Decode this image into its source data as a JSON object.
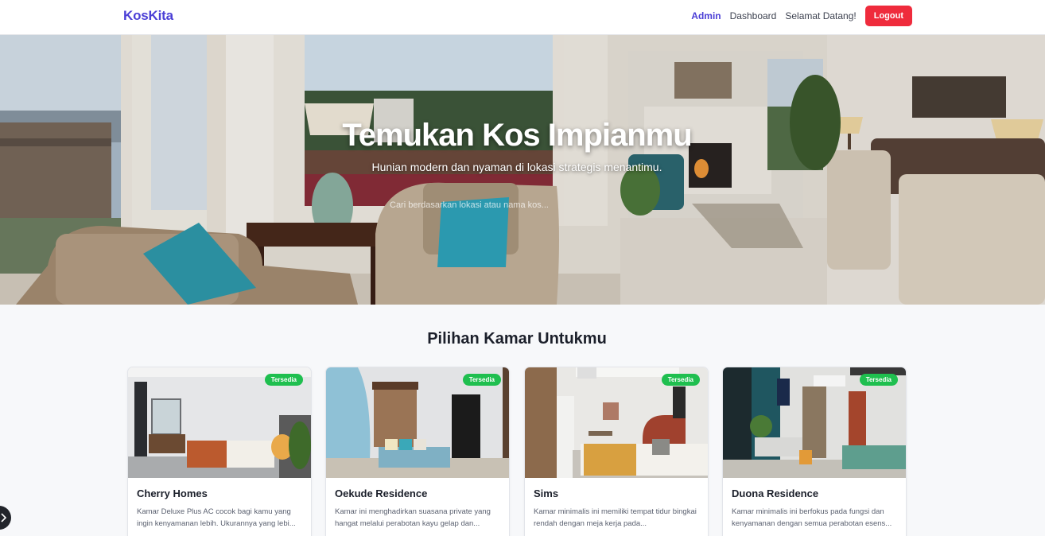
{
  "nav": {
    "brand": "KosKita",
    "links": [
      "Admin",
      "Dashboard",
      "Selamat Datang!"
    ],
    "logout_label": "Logout"
  },
  "hero": {
    "title": "Temukan Kos Impianmu",
    "subtitle": "Hunian modern dan nyaman di lokasi strategis menantimu.",
    "search_placeholder": "Cari berdasarkan lokasi atau nama kos..."
  },
  "section": {
    "title": "Pilihan Kamar Untukmu"
  },
  "cards": [
    {
      "name": "Cherry Homes",
      "status": "Tersedia",
      "description": "Kamar Deluxe Plus AC cocok bagi kamu yang ingin kenyamanan lebih. Ukurannya yang lebi..."
    },
    {
      "name": "Oekude Residence",
      "status": "Tersedia",
      "description": "Kamar ini menghadirkan suasana private yang hangat melalui perabotan kayu gelap dan..."
    },
    {
      "name": "Sims",
      "status": "Tersedia",
      "description": "Kamar minimalis ini memiliki tempat tidur bingkai rendah dengan meja kerja pada..."
    },
    {
      "name": "Duona Residence",
      "status": "Tersedia",
      "description": "Kamar minimalis ini berfokus pada fungsi dan kenyamanan dengan semua perabotan esens..."
    }
  ],
  "colors": {
    "brand": "#4b3fd6",
    "logout": "#ef2b3c",
    "badge": "#1fbf4f"
  }
}
